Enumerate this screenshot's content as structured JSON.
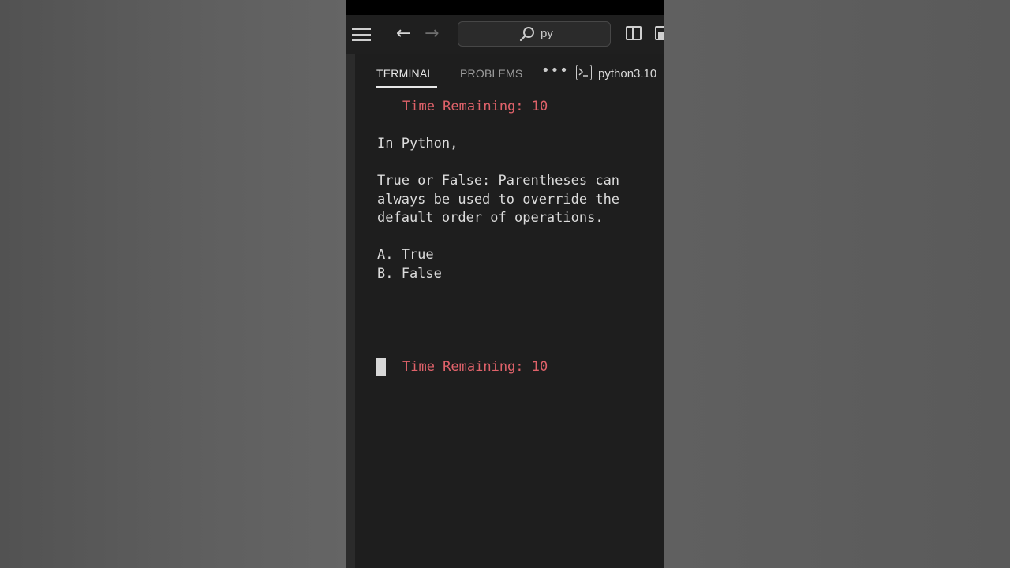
{
  "toolbar": {
    "search_text": "py"
  },
  "tabs": [
    {
      "label": "TERMINAL",
      "active": true
    },
    {
      "label": "PROBLEMS",
      "active": false
    }
  ],
  "terminal_profile": "python3.10",
  "terminal": {
    "timer_top": "Time Remaining: 10",
    "intro": "In Python,",
    "question_lines": [
      "True or False: Parentheses can",
      "always be used to override the",
      "default order of operations."
    ],
    "options": [
      "A. True",
      "B. False"
    ],
    "timer_bottom": "Time Remaining: 10"
  },
  "colors": {
    "timer": "#e0626a",
    "text": "#dcdcdc",
    "panel_bg": "#1e1e1e"
  },
  "icons": [
    "menu-icon",
    "back-arrow-icon",
    "forward-arrow-icon",
    "search-icon",
    "split-layout-icon",
    "panel-layout-icon",
    "more-icon",
    "terminal-icon"
  ]
}
